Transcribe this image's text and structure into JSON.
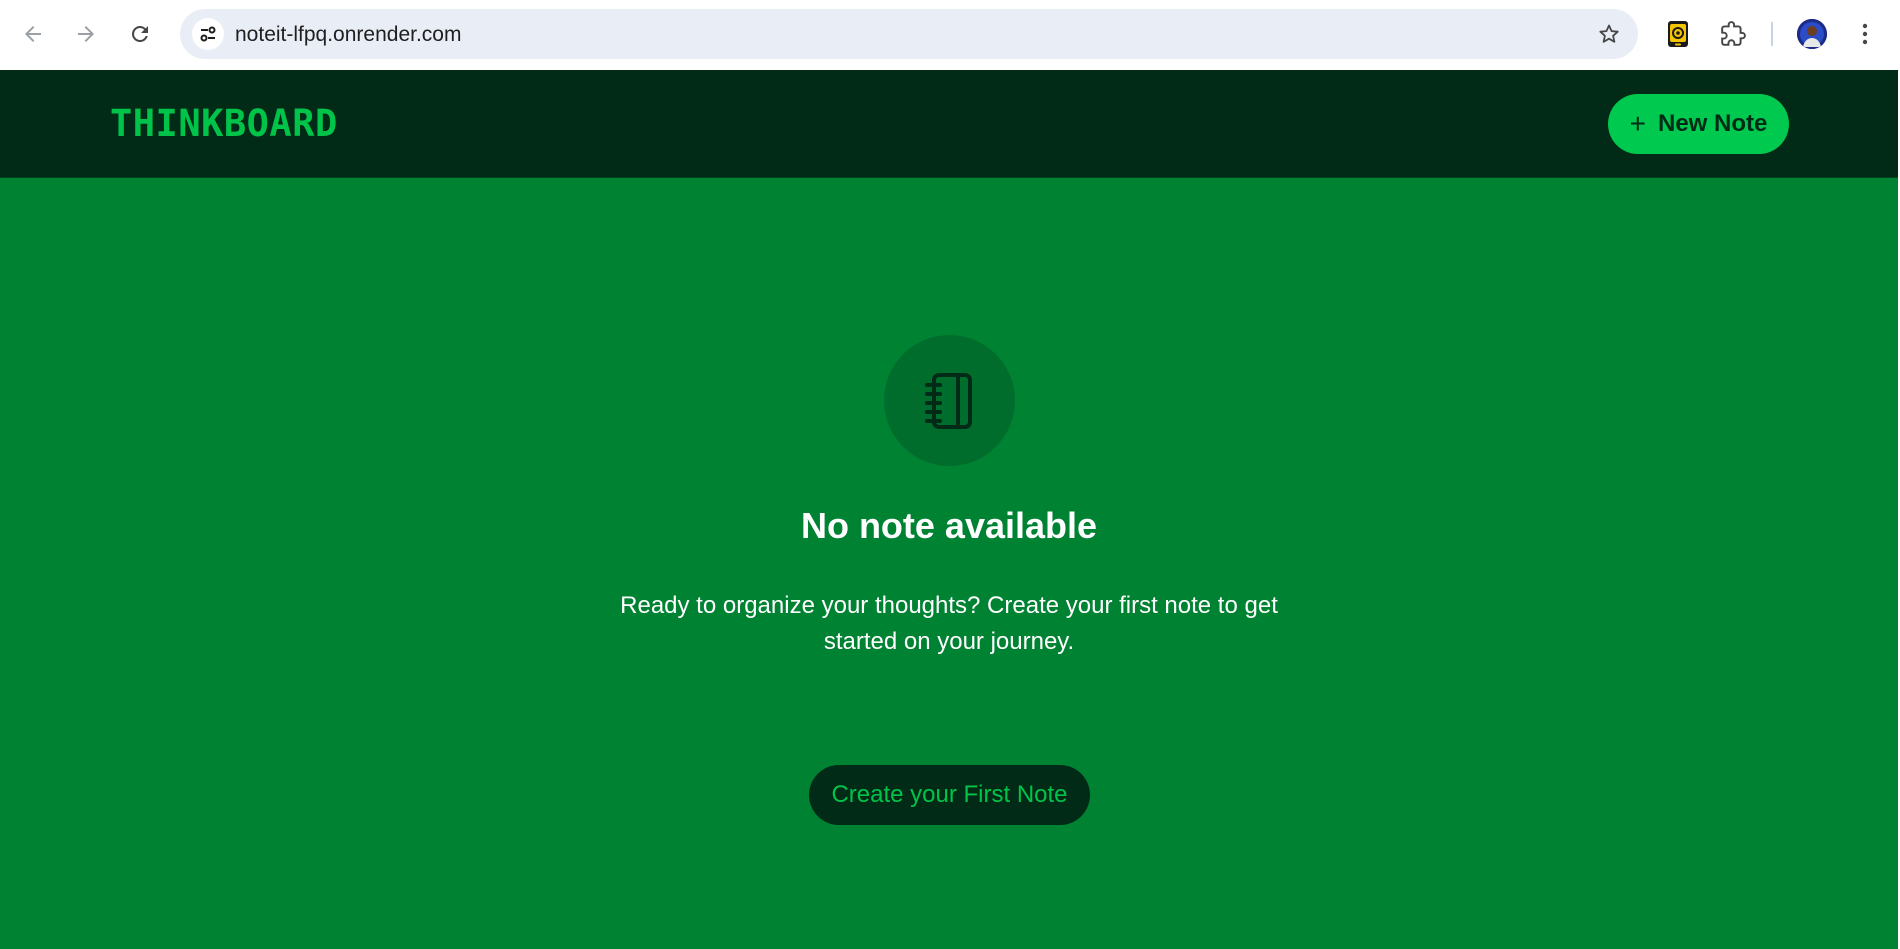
{
  "browser": {
    "url": "noteit-lfpq.onrender.com",
    "icons": {
      "back": "back-arrow-icon",
      "forward": "forward-arrow-icon",
      "reload": "reload-icon",
      "site_info": "tune-icon",
      "bookmark": "star-icon",
      "extension": "extension-app-icon",
      "extensions": "puzzle-icon",
      "profile": "avatar",
      "menu": "kebab-menu-icon"
    }
  },
  "header": {
    "logo": "THINKBOARD",
    "new_note_label": "New Note"
  },
  "empty_state": {
    "icon": "notebook-icon",
    "title": "No note available",
    "description": "Ready to organize your thoughts? Create your first note to get started on your journey.",
    "cta_label": "Create your First Note"
  },
  "colors": {
    "page_bg": "#008233",
    "header_bg": "#012b16",
    "accent": "#00c94f",
    "icon_circle": "#016d2c"
  }
}
